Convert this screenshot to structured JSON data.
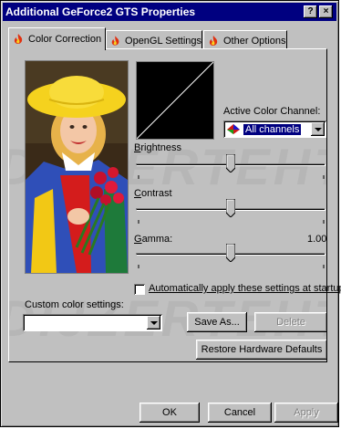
{
  "window": {
    "title": "Additional GeForce2 GTS Properties",
    "help_button": "?",
    "close_button": "×"
  },
  "tabs": [
    {
      "label": "Color Correction",
      "active": true
    },
    {
      "label": "OpenGL Settings",
      "active": false
    },
    {
      "label": "Other Options",
      "active": false
    }
  ],
  "color_correction": {
    "watermark_text": "DIJZERTEHT",
    "active_channel_label": "Active Color Channel:",
    "active_channel_value": "All channels",
    "brightness": {
      "label": "Brightness",
      "value": 0.5
    },
    "contrast": {
      "label": "Contrast",
      "value": 0.5
    },
    "gamma": {
      "label": "Gamma:",
      "value_text": "1.00",
      "value": 0.5
    },
    "auto_apply_label": "Automatically apply these settings at startup",
    "auto_apply_checked": false,
    "custom_settings_label": "Custom color settings:",
    "custom_settings_value": "",
    "save_as_label": "Save As...",
    "delete_label": "Delete",
    "restore_label": "Restore Hardware Defaults"
  },
  "footer": {
    "ok_label": "OK",
    "cancel_label": "Cancel",
    "apply_label": "Apply"
  },
  "colors": {
    "titlebar": "#000080",
    "face": "#c0c0c0",
    "selection": "#000080"
  }
}
